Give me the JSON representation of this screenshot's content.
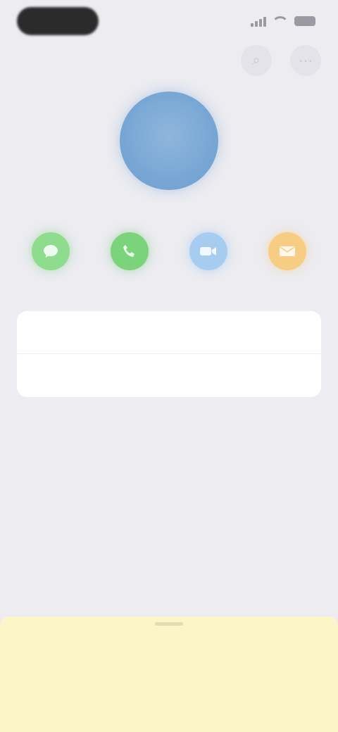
{
  "status_bar": {
    "time": "",
    "icons": [
      "signal-icon",
      "wifi-icon",
      "battery-icon"
    ]
  },
  "top_actions": [
    {
      "name": "search-icon",
      "glyph": "⌕"
    },
    {
      "name": "more-icon",
      "glyph": "⋯"
    }
  ],
  "contact": {
    "avatar_initial": "",
    "caption": ""
  },
  "quick_actions": [
    {
      "name": "message",
      "icon": "message-icon",
      "color": "#8fdc8f",
      "label": ""
    },
    {
      "name": "call",
      "icon": "phone-icon",
      "color": "#7bd47b",
      "label": ""
    },
    {
      "name": "video",
      "icon": "video-icon",
      "color": "#a6cdf0",
      "label": ""
    },
    {
      "name": "mail",
      "icon": "mail-icon",
      "color": "#f6cd82",
      "label": ""
    }
  ],
  "info_rows": [
    {
      "value": ""
    },
    {
      "value": ""
    }
  ],
  "bottom_sheet": {
    "line1": "",
    "line2": ""
  },
  "colors": {
    "background": "#ececf1",
    "accent": "#5d9ee5",
    "avatar": "#78a6d4",
    "sheet": "#fbf5c8"
  }
}
